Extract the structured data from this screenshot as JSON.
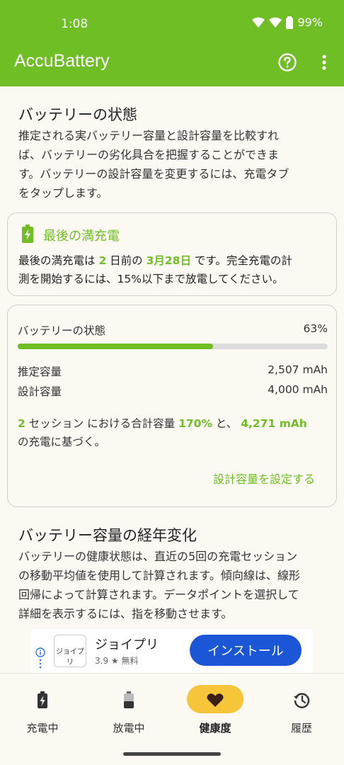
{
  "status": {
    "time": "1:08",
    "battery": "99%"
  },
  "app": {
    "title": "AccuBattery"
  },
  "section1": {
    "title": "バッテリーの状態",
    "lines": [
      "推定される実バッテリー容量と設計容量を比較すれ",
      "ば、バッテリーの劣化具合を把握することができま",
      "す。バッテリーの設計容量を変更するには、充電タブ",
      "をタップします。"
    ]
  },
  "last_charge": {
    "title": "最後の満充電",
    "text1": "最後の満充電は ",
    "days": "2",
    "text2": " 日前の ",
    "date": "3月28日",
    "text3": " です。完全充電の計",
    "line2": "測を開始するには、15%以下まで放電してください。"
  },
  "health": {
    "label": "バッテリーの状態",
    "percent_text": "63%",
    "percent": 63,
    "estimated_label": "推定容量",
    "estimated_value": "2,507 mAh",
    "design_label": "設計容量",
    "design_value": "4,000 mAh",
    "sessions": "2",
    "t1": " セッション における合計容量 ",
    "total_pct": "170%",
    "t2": " と、 ",
    "total_mah": "4,271 mAh",
    "line2": "の充電に基づく。",
    "link": "設計容量を設定する"
  },
  "section2": {
    "title": "バッテリー容量の経年変化",
    "lines": [
      "バッテリーの健康状態は、直近の5回の充電セッション",
      "の移動平均値を使用して計算されます。傾向線は、線形",
      "回帰によって計算されます。データポイントを選択して",
      "詳細を表示するには、指を移動させます。"
    ]
  },
  "ad": {
    "app_icon_text": "ジョイプリ",
    "name": "ジョイプリ",
    "rating": "3.9 ★  無料",
    "install": "インストール"
  },
  "nav": {
    "items": [
      {
        "label": "充電中",
        "icon": "battery-charging-icon"
      },
      {
        "label": "放電中",
        "icon": "battery-discharging-icon"
      },
      {
        "label": "健康度",
        "icon": "heart-icon"
      },
      {
        "label": "履歴",
        "icon": "history-icon"
      }
    ],
    "active": 2
  },
  "colors": {
    "accent": "#6fbe25",
    "nav_active": "#f7c53a",
    "install": "#1a56d6"
  }
}
